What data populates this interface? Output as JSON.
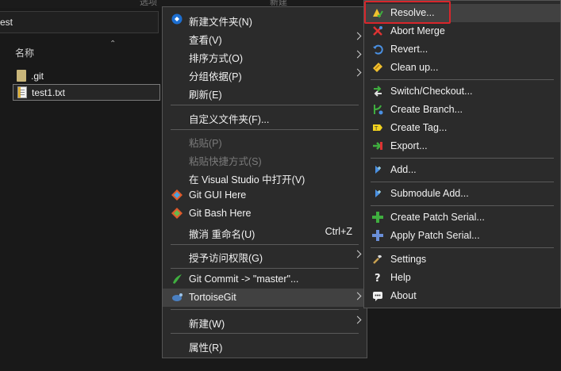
{
  "explorer": {
    "top_labels": [
      "选项",
      "新建"
    ],
    "address": "est",
    "column_name": "名称",
    "files": [
      ".git",
      "test1.txt"
    ]
  },
  "context_menu": {
    "items": [
      {
        "label": "新建文件夹(N)"
      },
      {
        "label": "查看(V)"
      },
      {
        "label": "排序方式(O)"
      },
      {
        "label": "分组依据(P)"
      },
      {
        "label": "刷新(E)"
      },
      {
        "label": "自定义文件夹(F)..."
      },
      {
        "label": "粘贴(P)"
      },
      {
        "label": "粘贴快捷方式(S)"
      },
      {
        "label": "在 Visual Studio 中打开(V)"
      },
      {
        "label": "Git GUI Here"
      },
      {
        "label": "Git Bash Here"
      },
      {
        "label": "撤消 重命名(U)",
        "shortcut": "Ctrl+Z"
      },
      {
        "label": "授予访问权限(G)"
      },
      {
        "label": "Git Commit -> \"master\"..."
      },
      {
        "label": "TortoiseGit"
      },
      {
        "label": "新建(W)"
      },
      {
        "label": "属性(R)"
      }
    ]
  },
  "tortoisegit_menu": {
    "items": [
      {
        "label": "Resolve..."
      },
      {
        "label": "Abort Merge"
      },
      {
        "label": "Revert..."
      },
      {
        "label": "Clean up..."
      },
      {
        "label": "Switch/Checkout..."
      },
      {
        "label": "Create Branch..."
      },
      {
        "label": "Create Tag..."
      },
      {
        "label": "Export..."
      },
      {
        "label": "Add..."
      },
      {
        "label": "Submodule Add..."
      },
      {
        "label": "Create Patch Serial..."
      },
      {
        "label": "Apply Patch Serial..."
      },
      {
        "label": "Settings"
      },
      {
        "label": "Help"
      },
      {
        "label": "About"
      }
    ]
  }
}
